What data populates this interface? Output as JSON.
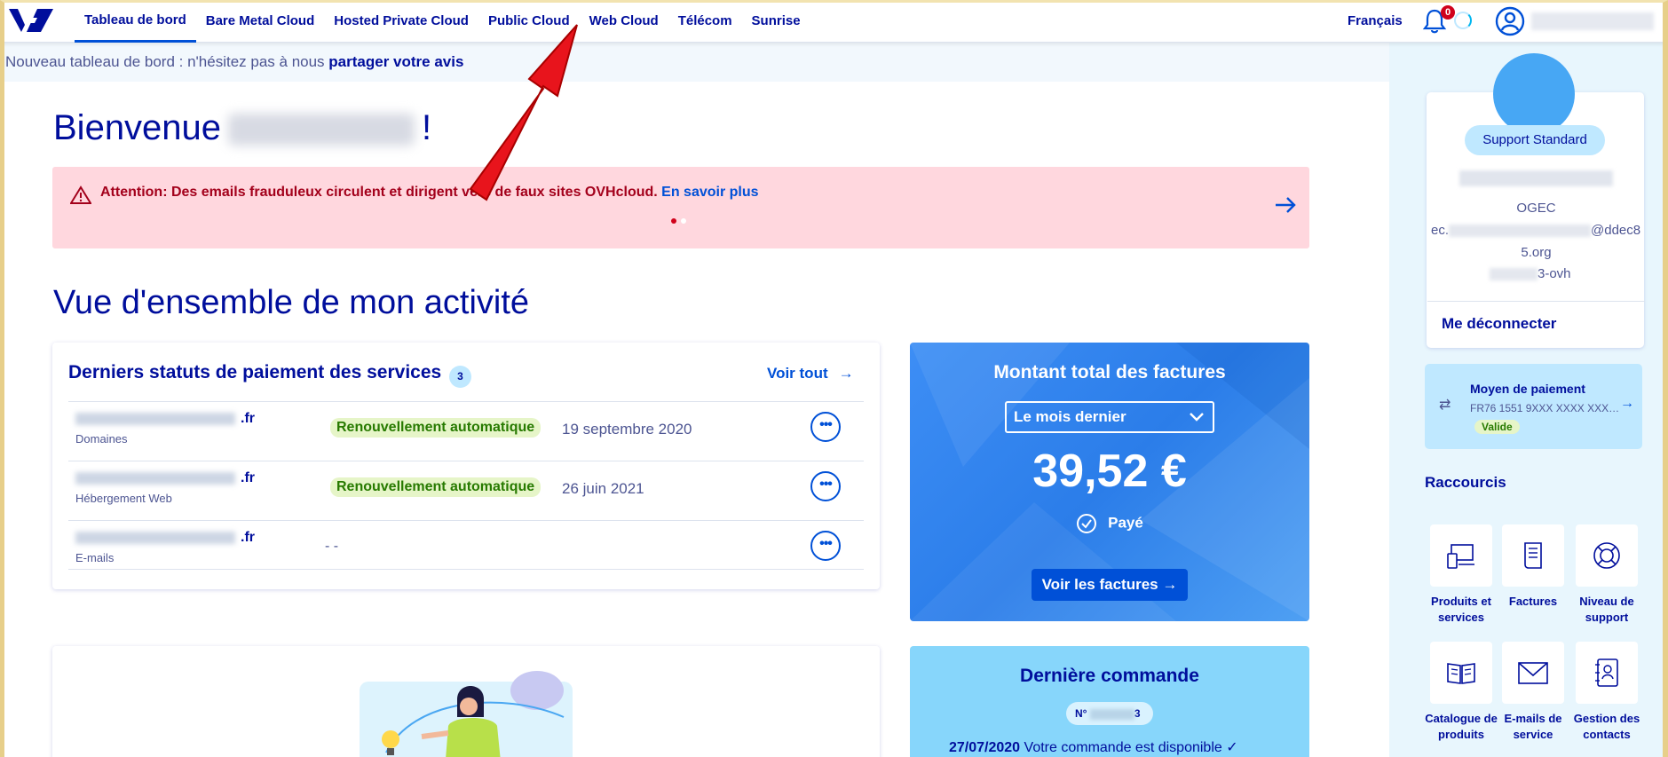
{
  "nav": {
    "items": [
      "Tableau de bord",
      "Bare Metal Cloud",
      "Hosted Private Cloud",
      "Public Cloud",
      "Web Cloud",
      "Télécom",
      "Sunrise"
    ],
    "language": "Français",
    "notification_count": "0"
  },
  "feedback": {
    "text": "Nouveau tableau de bord : n'hésitez pas à nous ",
    "link": "partager votre avis"
  },
  "welcome": {
    "greeting": "Bienvenue",
    "suffix": "!"
  },
  "alert": {
    "text": "Attention: Des emails frauduleux circulent et dirigent vers de faux sites OVHcloud.",
    "link": "En savoir plus"
  },
  "overview_title": "Vue d'ensemble de mon activité",
  "payments": {
    "title": "Derniers statuts de paiement des services",
    "count": "3",
    "see_all": "Voir tout",
    "rows": [
      {
        "tld": ".fr",
        "type": "Domaines",
        "status": "Renouvellement automatique",
        "date": "19 septembre 2020"
      },
      {
        "tld": ".fr",
        "type": "Hébergement Web",
        "status": "Renouvellement automatique",
        "date": "26 juin 2021"
      },
      {
        "tld": ".fr",
        "type": "E-mails",
        "status": "- -",
        "date": ""
      }
    ]
  },
  "bills": {
    "title": "Montant total des factures",
    "period": "Le mois dernier",
    "amount": "39,52 €",
    "status": "Payé",
    "button": "Voir les factures"
  },
  "order": {
    "title": "Dernière commande",
    "number_prefix": "N°",
    "number_suffix": "3",
    "date": "27/07/2020",
    "text": "Votre commande est disponible"
  },
  "profile": {
    "support": "Support Standard",
    "org": "OGEC",
    "email_prefix": "ec.",
    "email_suffix": "@ddec8",
    "email_end": "5.org",
    "nic_suffix": "3-ovh",
    "logout": "Me déconnecter"
  },
  "payment_method": {
    "title": "Moyen de paiement",
    "iban": "FR76 1551 9XXX XXXX XXX…",
    "status": "Valide"
  },
  "shortcuts": {
    "title": "Raccourcis",
    "items": [
      {
        "label": "Produits et services",
        "icon": "devices-icon"
      },
      {
        "label": "Factures",
        "icon": "invoice-icon"
      },
      {
        "label": "Niveau de support",
        "icon": "lifebuoy-icon"
      },
      {
        "label": "Catalogue de produits",
        "icon": "book-icon"
      },
      {
        "label": "E-mails de service",
        "icon": "envelope-icon"
      },
      {
        "label": "Gestion des contacts",
        "icon": "contacts-icon"
      }
    ]
  },
  "colors": {
    "primary": "#000e9c",
    "accent": "#0050d7",
    "alert_bg": "#ffd7de",
    "sidebar_bg": "#e8f6fd",
    "annotation_arrow": "#e8141c"
  }
}
